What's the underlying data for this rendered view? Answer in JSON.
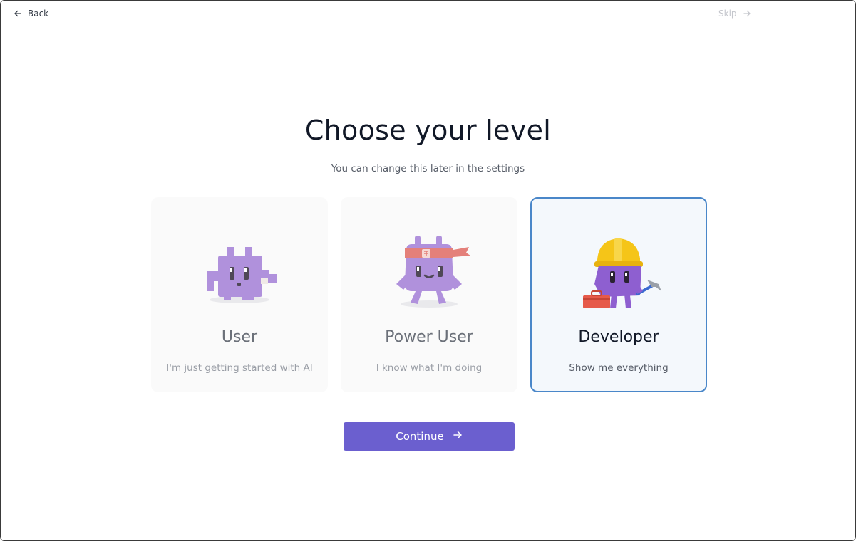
{
  "nav": {
    "back_label": "Back",
    "skip_label": "Skip"
  },
  "heading": {
    "title": "Choose your level",
    "subtitle": "You can change this later in the settings"
  },
  "levels": [
    {
      "label": "User",
      "description": "I'm just getting started with AI",
      "selected": false,
      "mascot": "purple-pixel-creature-icon"
    },
    {
      "label": "Power User",
      "description": "I know what I'm doing",
      "selected": false,
      "mascot": "purple-creature-headband-icon"
    },
    {
      "label": "Developer",
      "description": "Show me everything",
      "selected": true,
      "mascot": "purple-creature-hardhat-icon"
    }
  ],
  "actions": {
    "continue_label": "Continue"
  },
  "colors": {
    "accent": "#6b5fcf",
    "selected_border": "#4a87c9",
    "mascot_purple": "#a07ad6"
  }
}
